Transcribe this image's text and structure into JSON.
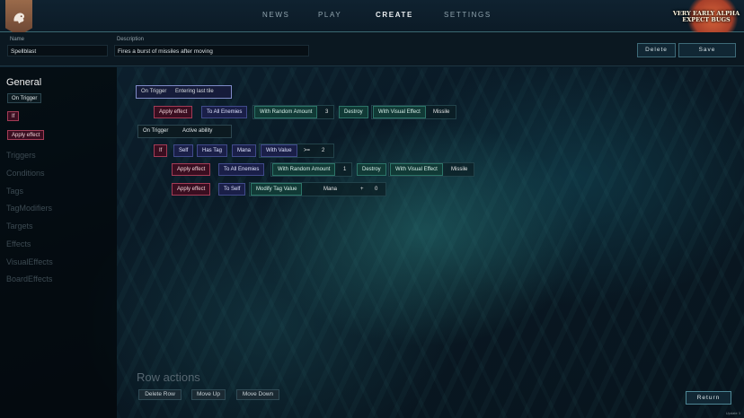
{
  "nav": {
    "items": [
      "NEWS",
      "PLAY",
      "CREATE",
      "SETTINGS"
    ],
    "active": "CREATE"
  },
  "alpha_banner": {
    "line1": "VERY EARLY ALPHA",
    "line2": "EXPECT BUGS"
  },
  "meta": {
    "name_label": "Name",
    "name_value": "Spellblast",
    "description_label": "Description",
    "description_value": "Fires a burst of missiles after moving",
    "delete_label": "Delete",
    "save_label": "Save"
  },
  "sidebar": {
    "heading": "General",
    "chips": {
      "trigger": "On Trigger",
      "if": "If",
      "effect": "Apply effect"
    },
    "categories": [
      "Triggers",
      "Conditions",
      "Tags",
      "TagModifiers",
      "Targets",
      "Effects",
      "VisualEffects",
      "BoardEffects"
    ]
  },
  "rows": {
    "r1": {
      "trigger": "On Trigger",
      "value": "Entering last tile"
    },
    "r2": {
      "effect": "Apply effect",
      "target": "To All Enemies",
      "modifier": "With Random Amount",
      "amount": "3",
      "destroy": "Destroy",
      "visual": "With Visual Effect",
      "visual_value": "Missile"
    },
    "r3": {
      "trigger": "On Trigger",
      "value": "Active ability"
    },
    "r4": {
      "if": "If",
      "self": "Self",
      "has_tag": "Has Tag",
      "tag": "Mana",
      "with_value": "With Value",
      "operator": ">=",
      "amount": "2"
    },
    "r5": {
      "effect": "Apply effect",
      "target": "To All Enemies",
      "modifier": "With Random Amount",
      "amount": "1",
      "destroy": "Destroy",
      "visual": "With Visual Effect",
      "visual_value": "Missile"
    },
    "r6": {
      "effect": "Apply effect",
      "target": "To Self",
      "modifier": "Modify Tag Value",
      "tag": "Mana",
      "operator": "+",
      "amount": "0"
    }
  },
  "row_actions": {
    "title": "Row actions",
    "delete": "Delete Row",
    "move_up": "Move Up",
    "move_down": "Move Down"
  },
  "return_label": "Return",
  "update_text": "Update 3",
  "colors": {
    "accent": "#4d8594",
    "effect": "#a33b56",
    "target": "#404a8a",
    "modifier": "#2c7468"
  }
}
